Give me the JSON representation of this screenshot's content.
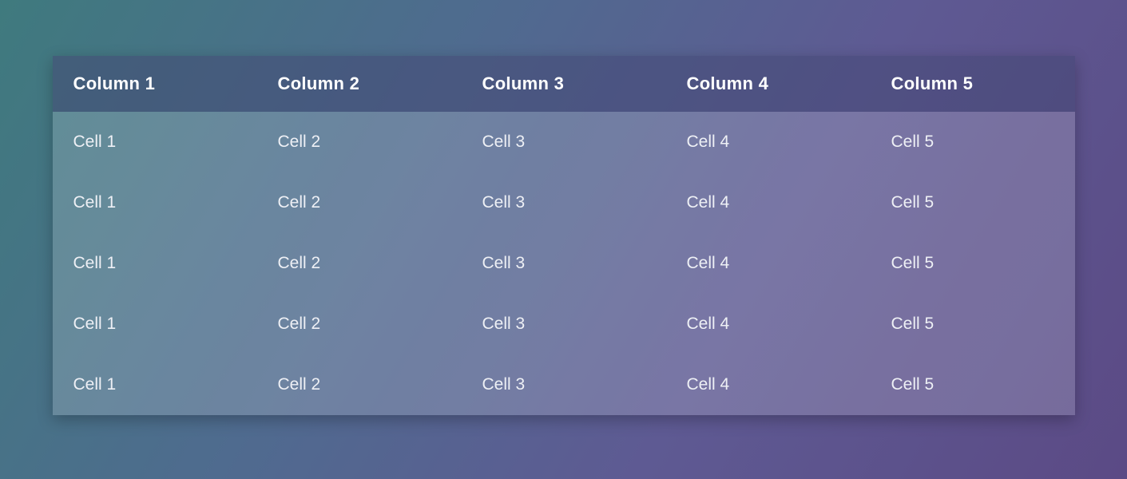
{
  "table": {
    "headers": [
      "Column 1",
      "Column 2",
      "Column 3",
      "Column 4",
      "Column 5"
    ],
    "rows": [
      [
        "Cell 1",
        "Cell 2",
        "Cell 3",
        "Cell 4",
        "Cell 5"
      ],
      [
        "Cell 1",
        "Cell 2",
        "Cell 3",
        "Cell 4",
        "Cell 5"
      ],
      [
        "Cell 1",
        "Cell 2",
        "Cell 3",
        "Cell 4",
        "Cell 5"
      ],
      [
        "Cell 1",
        "Cell 2",
        "Cell 3",
        "Cell 4",
        "Cell 5"
      ],
      [
        "Cell 1",
        "Cell 2",
        "Cell 3",
        "Cell 4",
        "Cell 5"
      ]
    ]
  }
}
